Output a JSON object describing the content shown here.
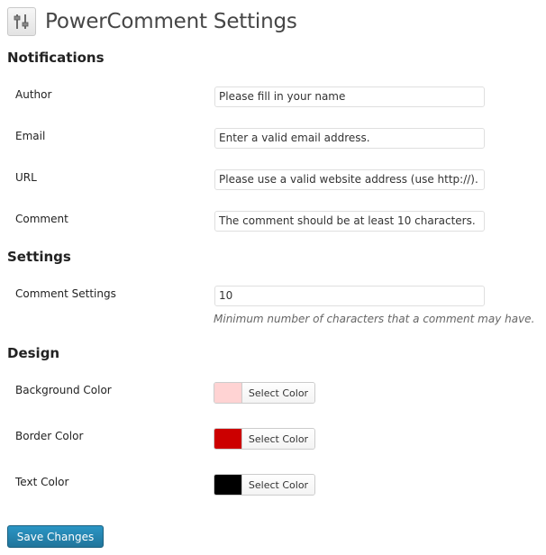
{
  "page": {
    "title": "PowerComment Settings",
    "icon": "settings-sliders-icon"
  },
  "notifications": {
    "heading": "Notifications",
    "fields": [
      {
        "label": "Author",
        "value": "Please fill in your name"
      },
      {
        "label": "Email",
        "value": "Enter a valid email address."
      },
      {
        "label": "URL",
        "value": "Please use a valid website address (use http://)."
      },
      {
        "label": "Comment",
        "value": "The comment should be at least 10 characters."
      }
    ]
  },
  "settings": {
    "heading": "Settings",
    "comment_settings": {
      "label": "Comment Settings",
      "value": "10",
      "hint": "Minimum number of characters that a comment may have."
    }
  },
  "design": {
    "heading": "Design",
    "colors": [
      {
        "label": "Background Color",
        "button": "Select Color",
        "color": "#ffd3d3"
      },
      {
        "label": "Border Color",
        "button": "Select Color",
        "color": "#cc0000"
      },
      {
        "label": "Text Color",
        "button": "Select Color",
        "color": "#000000"
      }
    ]
  },
  "actions": {
    "save_label": "Save Changes"
  },
  "colors": {
    "primary_button": "#21759b",
    "input_border": "#dfdfdf"
  }
}
